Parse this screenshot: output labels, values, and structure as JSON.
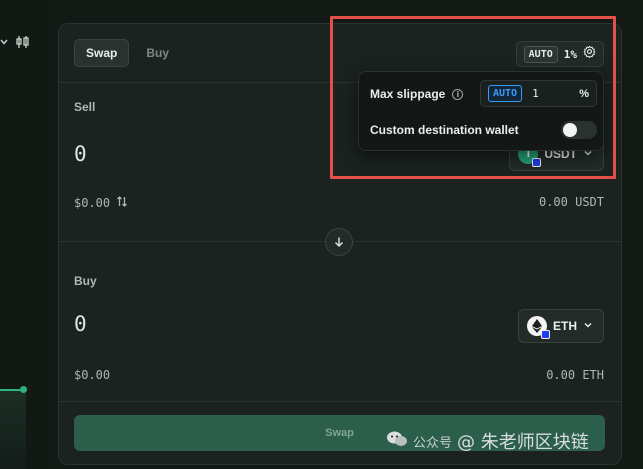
{
  "toolbar": {
    "chart_icon": "candlestick-icon"
  },
  "tabs": [
    {
      "label": "Swap",
      "active": true
    },
    {
      "label": "Buy",
      "active": false
    }
  ],
  "settings_pill": {
    "auto": "AUTO",
    "slippage": "1%",
    "icon": "gear-icon"
  },
  "sell": {
    "label": "Sell",
    "amount": "0",
    "fiat": "$0.00",
    "balance": "0.00 USDT",
    "token": "USDT"
  },
  "buy": {
    "label": "Buy",
    "amount": "0",
    "fiat": "$0.00",
    "balance": "0.00 ETH",
    "token": "ETH"
  },
  "cta": {
    "label": "Swap"
  },
  "popover": {
    "max_slippage_label": "Max slippage",
    "auto": "AUTO",
    "slippage_value": "1",
    "unit": "%",
    "custom_wallet_label": "Custom destination wallet",
    "custom_wallet_enabled": false
  },
  "watermark": {
    "prefix": "公众号",
    "text": "@ 朱老师区块链"
  },
  "colors": {
    "accent": "#2b5e4b",
    "highlight": "#e2504a",
    "auto_blue": "#3a9df5"
  }
}
